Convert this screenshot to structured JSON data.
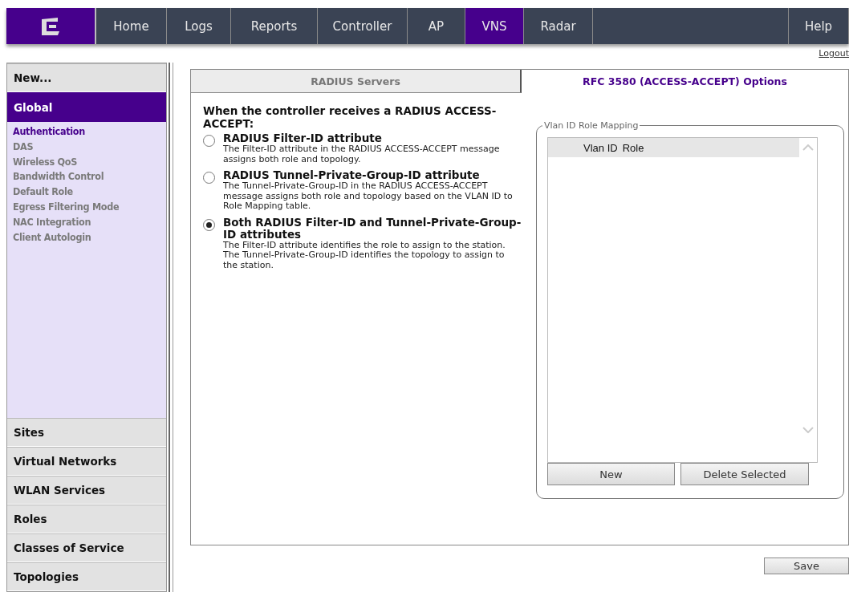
{
  "nav": [
    {
      "label": "Home",
      "selected": false
    },
    {
      "label": "Logs",
      "selected": false
    },
    {
      "label": "Reports",
      "selected": false
    },
    {
      "label": "Controller",
      "selected": false
    },
    {
      "label": "AP",
      "selected": false
    },
    {
      "label": "VNS",
      "selected": true
    },
    {
      "label": "Radar",
      "selected": false
    }
  ],
  "help": "Help",
  "logout": "Logout",
  "sidebar": {
    "top": "New...",
    "section": "Global",
    "items": [
      {
        "label": "Authentication",
        "selected": true
      },
      {
        "label": "DAS",
        "selected": false
      },
      {
        "label": "Wireless QoS",
        "selected": false
      },
      {
        "label": "Bandwidth Control",
        "selected": false
      },
      {
        "label": "Default Role",
        "selected": false
      },
      {
        "label": "Egress Filtering Mode",
        "selected": false
      },
      {
        "label": "NAC Integration",
        "selected": false
      },
      {
        "label": "Client Autologin",
        "selected": false
      }
    ],
    "groups": [
      "Sites",
      "Virtual Networks",
      "WLAN Services",
      "Roles",
      "Classes of Service",
      "Topologies"
    ]
  },
  "tabs": [
    {
      "label": "RADIUS Servers",
      "selected": false
    },
    {
      "label": "RFC 3580 (ACCESS-ACCEPT) Options",
      "selected": true
    }
  ],
  "heading": "When the controller receives a RADIUS ACCESS-ACCEPT:",
  "options": [
    {
      "title": "RADIUS Filter-ID attribute",
      "description": "The Filter-ID attribute in the RADIUS ACCESS-ACCEPT message assigns both role and topology.",
      "selected": false
    },
    {
      "title": "RADIUS Tunnel-Private-Group-ID attribute",
      "description": "The Tunnel-Private-Group-ID in the RADIUS ACCESS-ACCEPT message assigns both role and topology based on the VLAN ID to Role Mapping table.",
      "selected": false
    },
    {
      "title": "Both RADIUS Filter-ID and Tunnel-Private-Group-ID attributes",
      "description": "The Filter-ID attribute identifies the role to assign to the station. The Tunnel-Private-Group-ID identifies the topology to assign to the station.",
      "selected": true
    }
  ],
  "mapping": {
    "legend": "Vlan ID Role Mapping",
    "columns": [
      "Vlan ID",
      "Role"
    ],
    "buttons": [
      "New",
      "Delete Selected"
    ]
  },
  "save": "Save"
}
